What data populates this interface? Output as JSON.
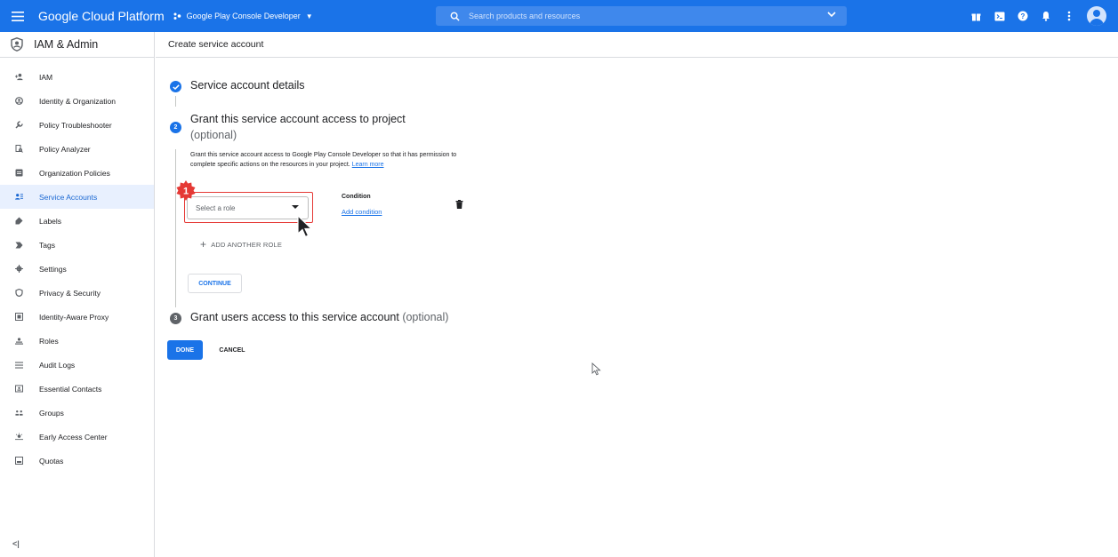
{
  "topbar": {
    "app_title": "Google Cloud Platform",
    "project_name": "Google Play Console Developer",
    "search_placeholder": "Search products and resources"
  },
  "sidebar": {
    "title": "IAM & Admin",
    "items": [
      {
        "label": "IAM",
        "icon": "person-add-icon"
      },
      {
        "label": "Identity & Organization",
        "icon": "account-circle-icon"
      },
      {
        "label": "Policy Troubleshooter",
        "icon": "wrench-icon"
      },
      {
        "label": "Policy Analyzer",
        "icon": "document-search-icon"
      },
      {
        "label": "Organization Policies",
        "icon": "list-box-icon"
      },
      {
        "label": "Service Accounts",
        "icon": "service-account-icon",
        "active": true
      },
      {
        "label": "Labels",
        "icon": "tag-icon"
      },
      {
        "label": "Tags",
        "icon": "chevron-tag-icon"
      },
      {
        "label": "Settings",
        "icon": "gear-icon"
      },
      {
        "label": "Privacy & Security",
        "icon": "shield-icon"
      },
      {
        "label": "Identity-Aware Proxy",
        "icon": "proxy-icon"
      },
      {
        "label": "Roles",
        "icon": "roles-icon"
      },
      {
        "label": "Audit Logs",
        "icon": "lines-icon"
      },
      {
        "label": "Essential Contacts",
        "icon": "contacts-icon"
      },
      {
        "label": "Groups",
        "icon": "groups-icon"
      },
      {
        "label": "Early Access Center",
        "icon": "early-access-icon"
      },
      {
        "label": "Quotas",
        "icon": "quotas-icon"
      }
    ],
    "collapse_label": "<|"
  },
  "page": {
    "title": "Create service account",
    "step1_title": "Service account details",
    "step2_title": "Grant this service account access to project",
    "step2_optional": "(optional)",
    "step2_desc": "Grant this service account access to Google Play Console Developer so that it has permission to complete specific actions on the resources in your project.",
    "learn_more": "Learn more",
    "role_placeholder": "Select a role",
    "condition_label": "Condition",
    "add_condition": "Add condition",
    "add_role": "ADD ANOTHER ROLE",
    "continue": "CONTINUE",
    "step3_title": "Grant users access to this service account",
    "step3_optional": "(optional)",
    "step3_number": "3",
    "step2_number": "2",
    "badge_number": "1",
    "done": "DONE",
    "cancel": "CANCEL"
  },
  "colors": {
    "primary": "#1a73e8",
    "highlight": "#e53935",
    "active_bg": "#e8f0fe"
  }
}
